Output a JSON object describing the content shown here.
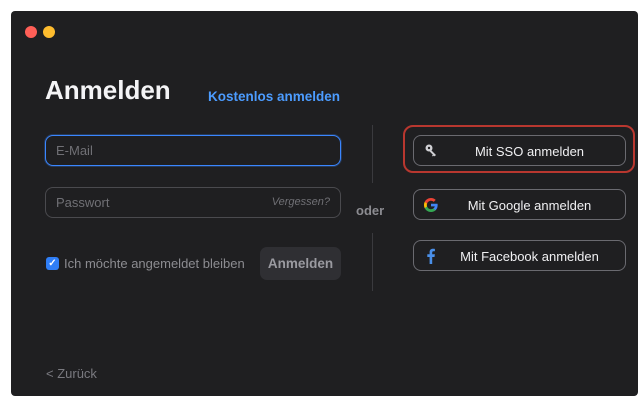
{
  "login": {
    "title": "Anmelden",
    "signup_link": "Kostenlos anmelden",
    "email_placeholder": "E-Mail",
    "password_placeholder": "Passwort",
    "forgot_label": "Vergessen?",
    "remember_label": "Ich möchte angemeldet bleiben",
    "remember_checked": true,
    "signin_label": "Anmelden",
    "back_label": "< Zurück"
  },
  "divider": {
    "label": "oder"
  },
  "social": {
    "sso_label": "Mit SSO anmelden",
    "sso_icon": "key-icon",
    "google_label": "Mit Google anmelden",
    "google_icon": "google-icon",
    "facebook_label": "Mit Facebook anmelden",
    "facebook_icon": "facebook-icon"
  },
  "colors": {
    "background": "#1f1f21",
    "accent": "#3a86ff",
    "highlight": "#b8372f"
  }
}
